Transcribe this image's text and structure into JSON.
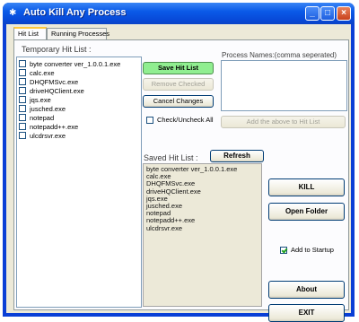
{
  "window": {
    "title": "Auto Kill Any Process",
    "minimize_label": "_",
    "maximize_label": "□",
    "close_label": "×"
  },
  "tabs": [
    {
      "label": "Hit List",
      "active": true
    },
    {
      "label": "Running Processes",
      "active": false
    }
  ],
  "temporary_hit_list": {
    "label": "Temporary Hit List :",
    "items": [
      {
        "label": "byte converter ver_1.0.0.1.exe",
        "checked": false
      },
      {
        "label": "calc.exe",
        "checked": false
      },
      {
        "label": "DHQFMSvc.exe",
        "checked": false
      },
      {
        "label": "driveHQClient.exe",
        "checked": false
      },
      {
        "label": "jqs.exe",
        "checked": false
      },
      {
        "label": "jusched.exe",
        "checked": false
      },
      {
        "label": "notepad",
        "checked": false
      },
      {
        "label": "notepadd++.exe",
        "checked": false
      },
      {
        "label": "ulcdrsvr.exe",
        "checked": false
      }
    ]
  },
  "buttons": {
    "save_hit_list": "Save Hit List",
    "remove_checked": "Remove Checked",
    "cancel_changes": "Cancel Changes",
    "add_to_hit_list": "Add the above to Hit List",
    "refresh": "Refresh",
    "kill": "KILL",
    "open_folder": "Open Folder",
    "about": "About",
    "exit": "EXIT"
  },
  "check_uncheck_all": {
    "label": "Check/Uncheck All",
    "checked": false
  },
  "process_names": {
    "label": "Process Names:(comma seperated)",
    "value": ""
  },
  "saved_hit_list": {
    "label": "Saved Hit List :",
    "items": [
      "byte converter ver_1.0.0.1.exe",
      "calc.exe",
      "DHQFMSvc.exe",
      "driveHQClient.exe",
      "jqs.exe",
      "jusched.exe",
      "notepad",
      "notepadd++.exe",
      "ulcdrsvr.exe"
    ]
  },
  "add_to_startup": {
    "label": "Add to Startup",
    "checked": true
  },
  "colors": {
    "title_bar": "#0a5ae8",
    "save_button": "#90ee90",
    "panel_background": "#ece9d8"
  }
}
